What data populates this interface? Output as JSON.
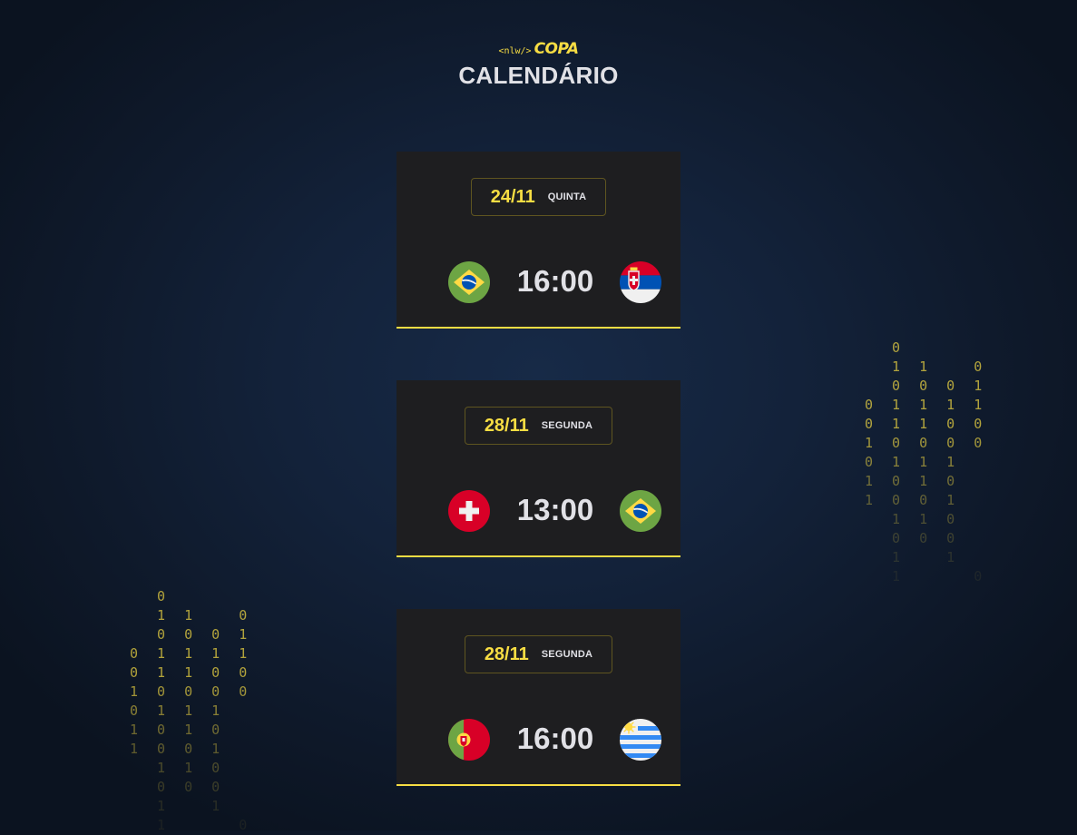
{
  "header": {
    "logo_tag": "<nlw/>",
    "logo_name": "COPA",
    "title": "CALENDÁRIO"
  },
  "matches": [
    {
      "date": "24/11",
      "weekday": "QUINTA",
      "time": "16:00",
      "home_flag": "brazil-flag-icon",
      "away_flag": "serbia-flag-icon"
    },
    {
      "date": "28/11",
      "weekday": "SEGUNDA",
      "time": "13:00",
      "home_flag": "switzerland-flag-icon",
      "away_flag": "brazil-flag-icon"
    },
    {
      "date": "28/11",
      "weekday": "SEGUNDA",
      "time": "16:00",
      "home_flag": "portugal-flag-icon",
      "away_flag": "uruguay-flag-icon"
    }
  ],
  "decor": {
    "binary_lines": [
      "  0",
      "  1 1   0",
      "  0 0 0 1",
      "0 1 1 1 1",
      "0 1 1 0 0",
      "1 0 0 0 0",
      "0 1 1 1",
      "1 0 1 0",
      "1 0 0 1",
      "  1 1 0",
      "  0 0 0",
      "  1   1",
      "  1     0"
    ]
  },
  "colors": {
    "accent": "#f7dd43",
    "card": "#1e1e20",
    "text": "#e1e1e6"
  }
}
